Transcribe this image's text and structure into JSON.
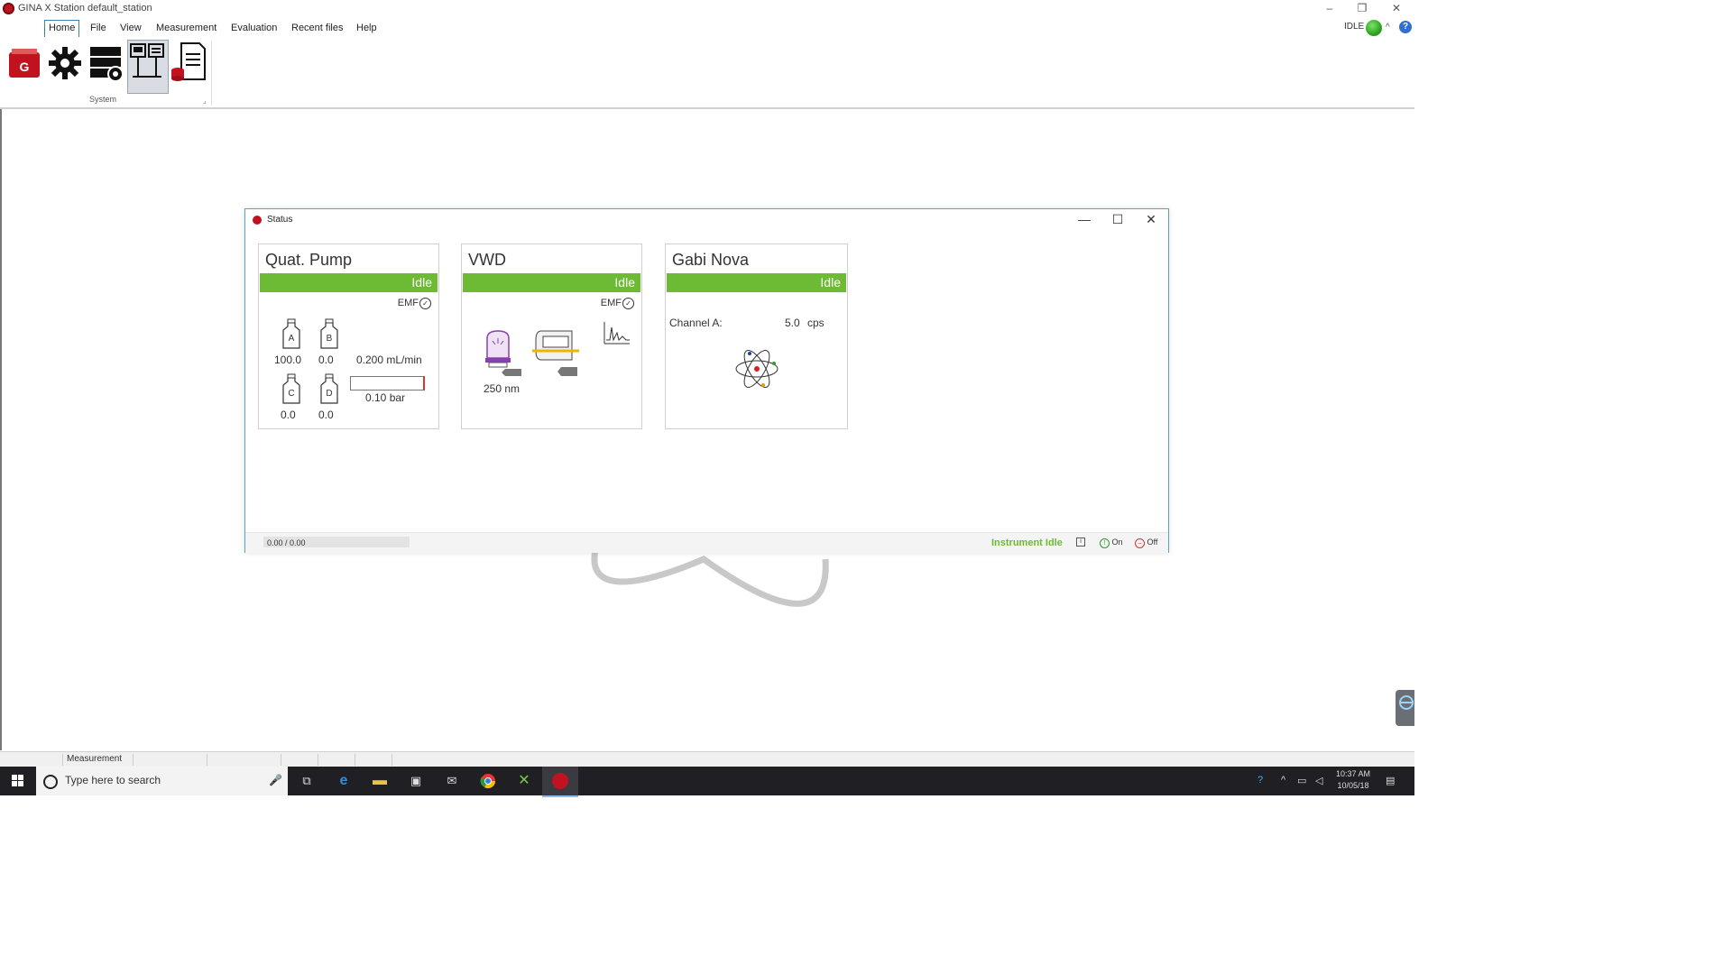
{
  "window": {
    "title": "GINA X Station default_station",
    "controls": {
      "minimize": "–",
      "restore": "❐",
      "close": "✕"
    }
  },
  "menu": {
    "items": [
      "Home",
      "File",
      "View",
      "Measurement",
      "Evaluation",
      "Recent files",
      "Help"
    ],
    "active": "Home"
  },
  "header_status": {
    "state_text": "IDLE",
    "led_color": "#2fa321"
  },
  "ribbon": {
    "group_label": "System",
    "buttons": [
      {
        "name": "gina-icon"
      },
      {
        "name": "settings-icon"
      },
      {
        "name": "instrument-config-icon"
      },
      {
        "name": "status-monitor-icon",
        "selected": true
      },
      {
        "name": "audit-trail-icon"
      }
    ]
  },
  "status_window": {
    "title": "Status",
    "controls": {
      "minimize": "—",
      "maximize": "☐",
      "close": "✕"
    },
    "cards": {
      "pump": {
        "title": "Quat. Pump",
        "status": "Idle",
        "emf": "EMF",
        "bottles": [
          {
            "label": "A",
            "value": "100.0"
          },
          {
            "label": "B",
            "value": "0.0"
          },
          {
            "label": "C",
            "value": "0.0"
          },
          {
            "label": "D",
            "value": "0.0"
          }
        ],
        "flow": "0.200 mL/min",
        "pressure": "0.10 bar"
      },
      "vwd": {
        "title": "VWD",
        "status": "Idle",
        "emf": "EMF",
        "wavelength": "250 nm"
      },
      "gabi": {
        "title": "Gabi Nova",
        "status": "Idle",
        "channel_label": "Channel A:",
        "channel_value": "5.0",
        "channel_unit": "cps"
      }
    },
    "footer": {
      "progress": "0.00 / 0.00",
      "instrument_state": "Instrument Idle",
      "on_label": "On",
      "off_label": "Off"
    }
  },
  "app_status_bar": {
    "mode": "Measurement"
  },
  "taskbar": {
    "search_placeholder": "Type here to search",
    "time": "10:37 AM",
    "date": "10/05/18"
  },
  "colors": {
    "status_green": "#6dbb35",
    "accent_red": "#c1121f"
  }
}
